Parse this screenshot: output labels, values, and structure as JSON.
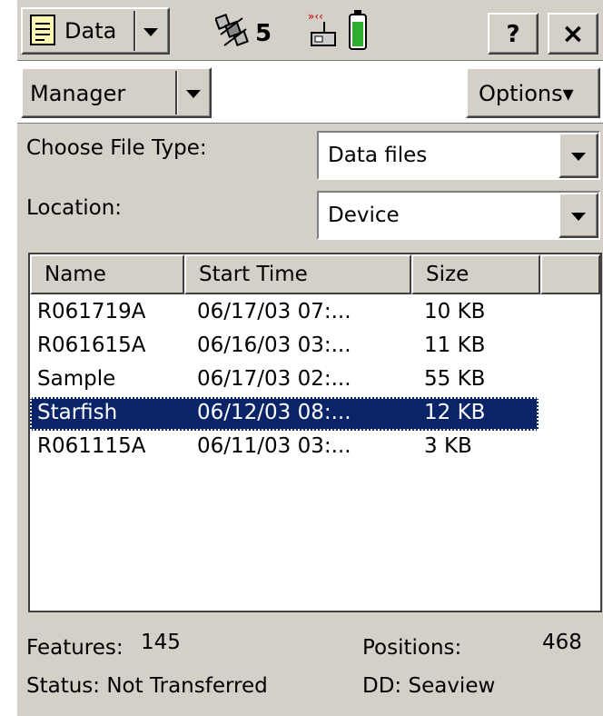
{
  "titlebar": {
    "app_menu_label": "Data",
    "satellites": "5",
    "help_label": "?",
    "close_label": "×"
  },
  "toolbar": {
    "section_label": "Manager",
    "options_label": "Options▾"
  },
  "form": {
    "file_type_label": "Choose File Type:",
    "file_type_value": "Data files",
    "location_label": "Location:",
    "location_value": "Device"
  },
  "file_list": {
    "columns": [
      "Name",
      "Start Time",
      "Size",
      ""
    ],
    "rows": [
      {
        "name": "R061719A",
        "start": "06/17/03 07:...",
        "size": "10 KB",
        "selected": false
      },
      {
        "name": "R061615A",
        "start": "06/16/03 03:...",
        "size": "11 KB",
        "selected": false
      },
      {
        "name": "Sample",
        "start": "06/17/03 02:...",
        "size": "55 KB",
        "selected": false
      },
      {
        "name": "Starfish",
        "start": "06/12/03 08:...",
        "size": "12 KB",
        "selected": true
      },
      {
        "name": "R061115A",
        "start": "06/11/03 03:...",
        "size": "3 KB",
        "selected": false
      }
    ]
  },
  "details": {
    "features_label": "Features:",
    "features_value": "145",
    "positions_label": "Positions:",
    "positions_value": "468",
    "status_text": "Status: Not Transferred",
    "dd_text": "DD: Seaview"
  },
  "icons": {
    "app_menu": "document-icon",
    "satellite": "satellite-icon",
    "gps_receiver": "gps-receiver-icon",
    "battery": "battery-icon"
  },
  "colors": {
    "selection": "#0a246a",
    "chrome": "#d4d0c8",
    "battery_fill": "#2fae2f"
  }
}
